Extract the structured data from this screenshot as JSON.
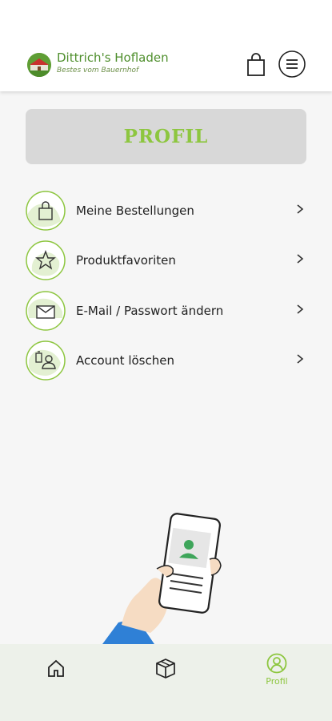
{
  "header": {
    "brand_title": "Dittrich's Hofladen",
    "brand_subtitle": "Bestes vom Bauernhof",
    "logo_icon": "farm-logo-icon",
    "cart_icon": "shopping-bag-icon",
    "menu_icon": "hamburger-menu-icon"
  },
  "page": {
    "title": "PROFIL"
  },
  "menu": {
    "items": [
      {
        "label": "Meine Bestellungen",
        "icon": "shopping-bag-icon"
      },
      {
        "label": "Produktfavoriten",
        "icon": "star-icon"
      },
      {
        "label": "E-Mail / Passwort ändern",
        "icon": "envelope-icon"
      },
      {
        "label": "Account löschen",
        "icon": "delete-user-icon"
      }
    ]
  },
  "bottom_nav": {
    "items": [
      {
        "label": "",
        "icon": "home-icon",
        "active": false
      },
      {
        "label": "",
        "icon": "box-icon",
        "active": false
      },
      {
        "label": "Profil",
        "icon": "profile-icon",
        "active": true
      }
    ]
  },
  "colors": {
    "accent": "#8dc63f",
    "brand": "#4f8f2d",
    "banner": "#d8d8d8",
    "nav_bg": "#edf1ea"
  }
}
